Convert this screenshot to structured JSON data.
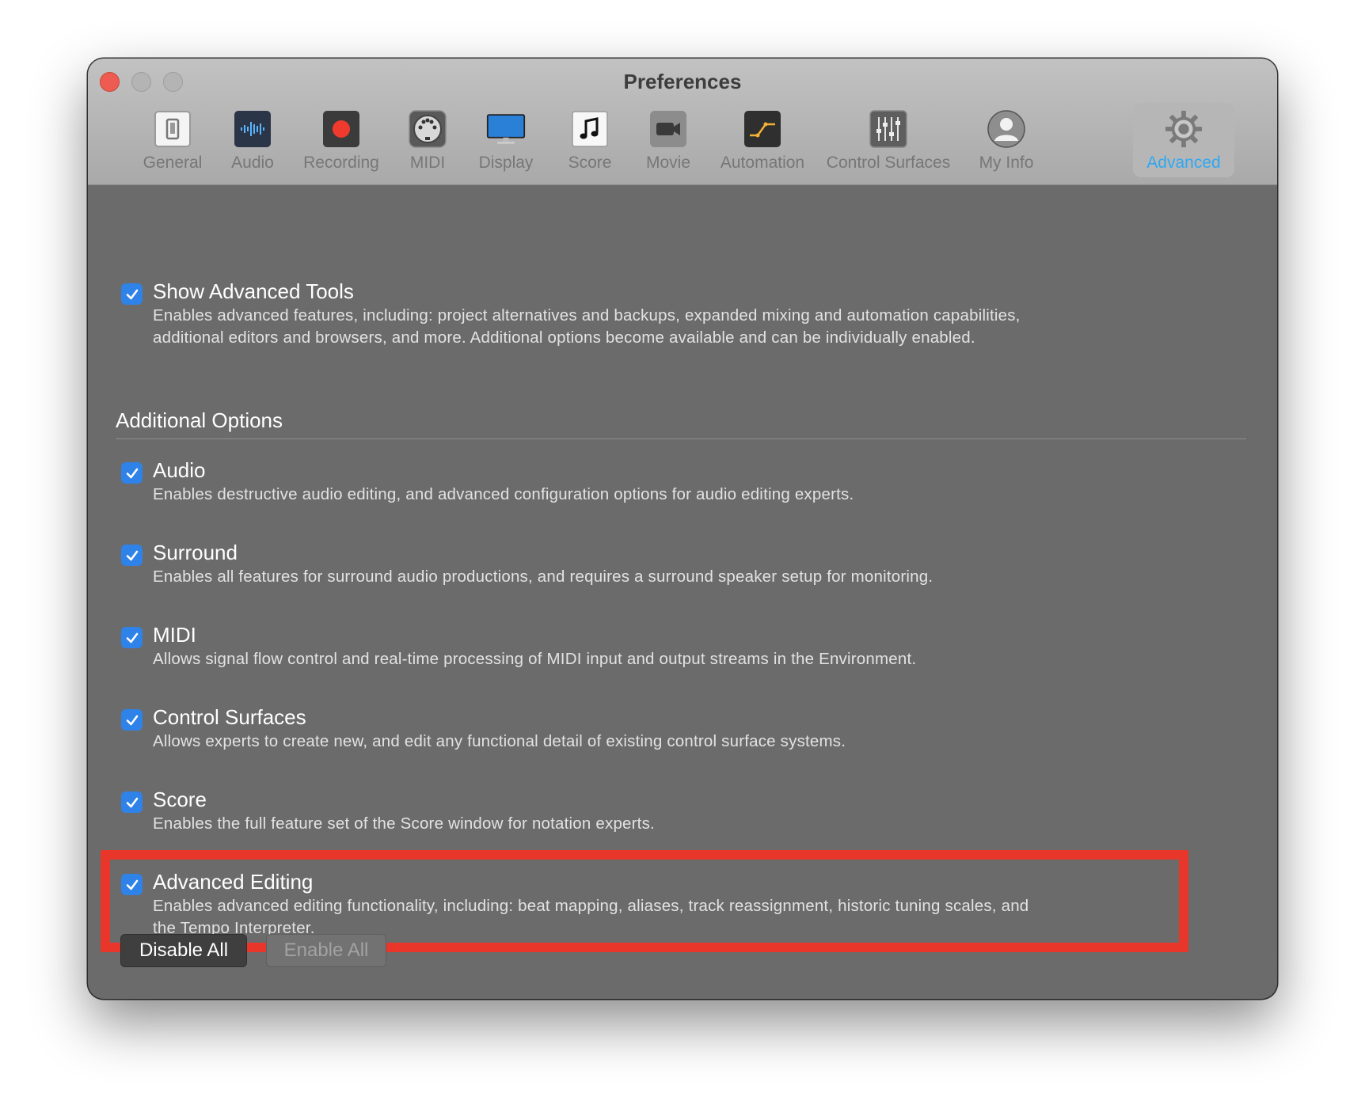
{
  "window": {
    "title": "Preferences"
  },
  "toolbar": {
    "items": [
      {
        "label": "General",
        "icon": "general-icon"
      },
      {
        "label": "Audio",
        "icon": "audio-waveform-icon"
      },
      {
        "label": "Recording",
        "icon": "record-icon"
      },
      {
        "label": "MIDI",
        "icon": "midi-connector-icon"
      },
      {
        "label": "Display",
        "icon": "display-monitor-icon"
      },
      {
        "label": "Score",
        "icon": "music-note-icon"
      },
      {
        "label": "Movie",
        "icon": "movie-camera-icon"
      },
      {
        "label": "Automation",
        "icon": "automation-curve-icon"
      },
      {
        "label": "Control Surfaces",
        "icon": "faders-icon"
      },
      {
        "label": "My Info",
        "icon": "user-silhouette-icon"
      },
      {
        "label": "Advanced",
        "icon": "gear-icon",
        "selected": true
      }
    ]
  },
  "main_option": {
    "label": "Show Advanced Tools",
    "checked": true,
    "description_line1": "Enables advanced features, including: project alternatives and backups, expanded mixing and automation capabilities,",
    "description_line2": "additional editors and browsers, and more. Additional options become available and can be individually enabled."
  },
  "section": {
    "title": "Additional Options"
  },
  "options": [
    {
      "label": "Audio",
      "checked": true,
      "description": "Enables destructive audio editing, and advanced configuration options for audio editing experts."
    },
    {
      "label": "Surround",
      "checked": true,
      "description": "Enables all features for surround audio productions, and requires a surround speaker setup for monitoring."
    },
    {
      "label": "MIDI",
      "checked": true,
      "description": "Allows signal flow control and real-time processing of MIDI input and output streams in the Environment."
    },
    {
      "label": "Control Surfaces",
      "checked": true,
      "description": "Allows experts to create new, and edit any functional detail of existing control surface systems."
    },
    {
      "label": "Score",
      "checked": true,
      "description": "Enables the full feature set of the Score window for notation experts."
    }
  ],
  "advanced_editing": {
    "label": "Advanced Editing",
    "checked": true,
    "description_line1": "Enables advanced editing functionality, including: beat mapping, aliases, track reassignment, historic tuning scales, and",
    "description_line2": "the Tempo Interpreter."
  },
  "buttons": {
    "disable_all": "Disable All",
    "enable_all": "Enable All"
  },
  "colors": {
    "accent_blue": "#2f82e8",
    "selected_tab_label": "#2fa8f2",
    "highlight_red": "#e8362a",
    "close_red": "#ee5b50"
  }
}
